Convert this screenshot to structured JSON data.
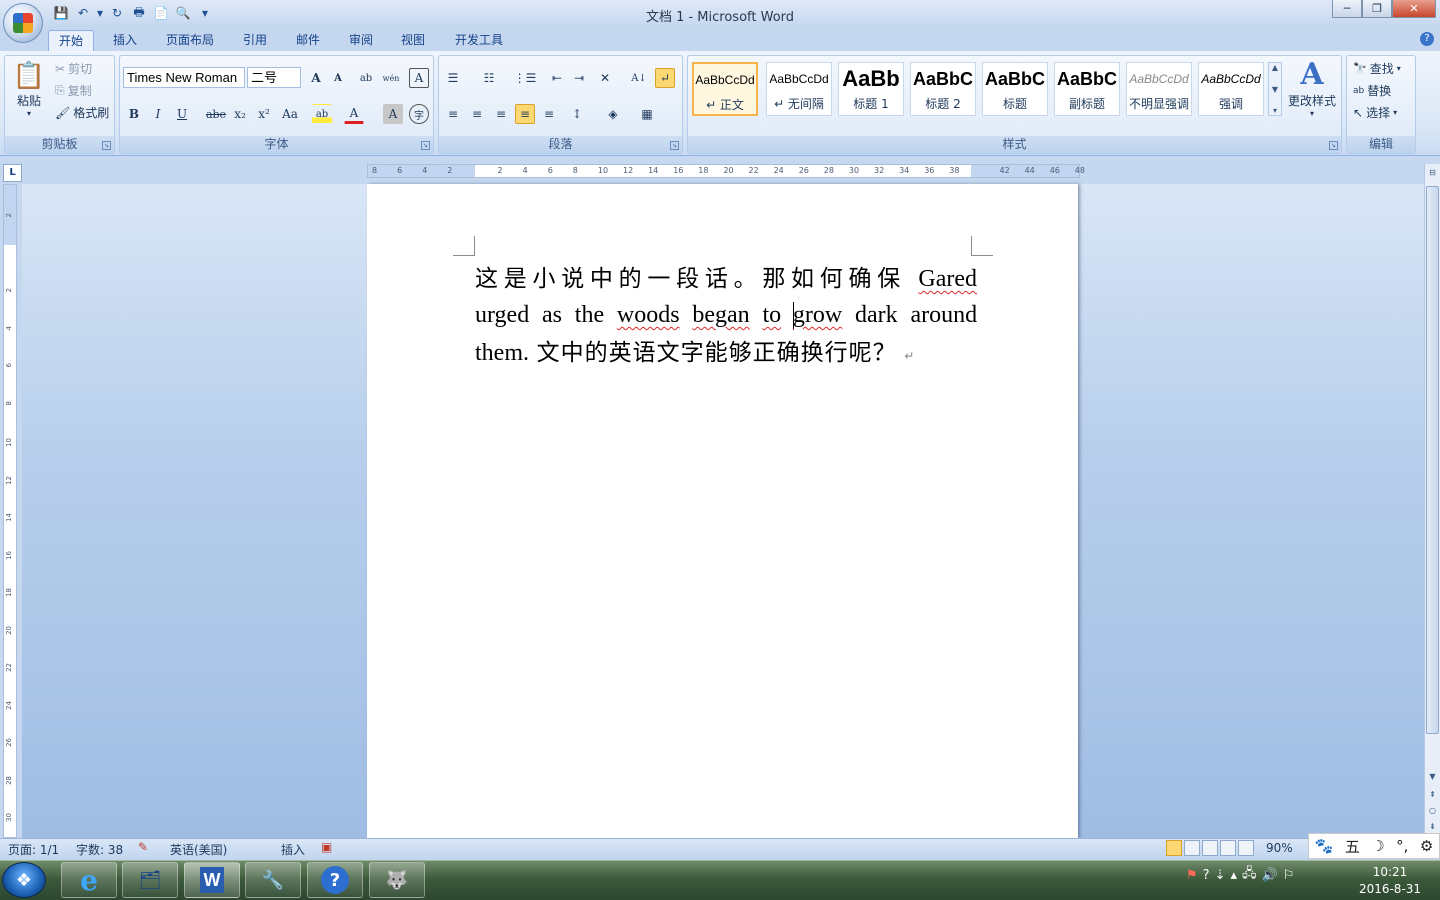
{
  "window": {
    "title": "文档 1 - Microsoft Word",
    "min": "─",
    "max": "❐",
    "close": "✕"
  },
  "qat": {
    "save": "💾",
    "undo": "↶",
    "undo_dd": "▾",
    "redo": "↻",
    "print": "🖶",
    "new": "📄",
    "preview": "🔍",
    "customize": "▾"
  },
  "tabs": [
    "开始",
    "插入",
    "页面布局",
    "引用",
    "邮件",
    "审阅",
    "视图",
    "开发工具"
  ],
  "help": "?",
  "clipboard": {
    "paste": "粘贴",
    "paste_icon": "📋",
    "cut": "剪切",
    "copy": "复制",
    "format_painter": "格式刷",
    "label": "剪贴板",
    "cut_icon": "✂",
    "copy_icon": "⎘",
    "fp_icon": "🖌"
  },
  "font": {
    "name": "Times New Roman",
    "size": "二号",
    "grow": "A",
    "shrink": "A",
    "clear": "ab",
    "phonetic": "wén",
    "border": "A",
    "bold": "B",
    "italic": "I",
    "underline": "U",
    "strike": "abe",
    "subscript": "x₂",
    "superscript": "x²",
    "case": "Aa",
    "highlight": "ab",
    "color": "A",
    "shade": "A",
    "enclose": "字",
    "label": "字体"
  },
  "paragraph": {
    "label": "段落",
    "bullets": "☰",
    "numbering": "☷",
    "multilevel": "⋮☰",
    "dec_indent": "⇤",
    "inc_indent": "⇥",
    "chinese_layout": "✕",
    "sort": "A↓",
    "show_marks": "↵",
    "align_left": "≡",
    "center": "≡",
    "align_right": "≡",
    "justify": "≡",
    "distribute": "≡",
    "line_spacing": "↕",
    "shading": "◈",
    "borders": "▦"
  },
  "styles": {
    "label": "样式",
    "items": [
      {
        "preview": "AaBbCcDd",
        "name": "↵ 正文"
      },
      {
        "preview": "AaBbCcDd",
        "name": "↵ 无间隔"
      },
      {
        "preview": "AaBb",
        "name": "标题 1"
      },
      {
        "preview": "AaBbC",
        "name": "标题 2"
      },
      {
        "preview": "AaBbC",
        "name": "标题"
      },
      {
        "preview": "AaBbC",
        "name": "副标题"
      },
      {
        "preview": "AaBbCcDd",
        "name": "不明显强调"
      },
      {
        "preview": "AaBbCcDd",
        "name": "强调"
      }
    ],
    "change_styles": "更改样式",
    "change_icon": "A"
  },
  "editing": {
    "label": "编辑",
    "find": "查找",
    "replace": "替换",
    "select": "选择",
    "find_icon": "🔭",
    "replace_icon": "ab",
    "select_icon": "↖"
  },
  "ruler": {
    "corner": "L",
    "hnums": [
      "8",
      "6",
      "4",
      "2",
      "",
      "2",
      "4",
      "6",
      "8",
      "10",
      "12",
      "14",
      "16",
      "18",
      "20",
      "22",
      "24",
      "26",
      "28",
      "30",
      "32",
      "34",
      "36",
      "38",
      "",
      "42",
      "44",
      "46",
      "48"
    ],
    "vnums": [
      "2",
      "",
      "2",
      "4",
      "6",
      "8",
      "10",
      "12",
      "14",
      "16",
      "18",
      "20",
      "22",
      "24",
      "26",
      "28",
      "30"
    ]
  },
  "document": {
    "line1_cjk": "这是小说中的一段话。那如何确保",
    "line1_word": "Gared",
    "line2": [
      "urged",
      "as",
      "the",
      "woods",
      "began",
      "to",
      "grow",
      "dark",
      "around"
    ],
    "line3_lat": "them.",
    "line3_cjk": "文中的英语文字能够正确换行呢？",
    "para_mark": "↵"
  },
  "status": {
    "page": "页面: 1/1",
    "words": "字数: 38",
    "proof_icon": "✎",
    "language": "英语(美国)",
    "mode": "插入",
    "macro_icon": "▣",
    "zoom": "90%"
  },
  "ime": {
    "paw": "🐾",
    "wubi": "五",
    "moon": "☽",
    "punct": "°,",
    "gear": "⚙"
  },
  "taskbar": {
    "start": "❖",
    "apps": [
      {
        "name": "ie",
        "icon": "e"
      },
      {
        "name": "explorer",
        "icon": "🗂"
      },
      {
        "name": "word",
        "icon": "W"
      },
      {
        "name": "tool",
        "icon": "🔧"
      },
      {
        "name": "help",
        "icon": "?"
      },
      {
        "name": "gimp",
        "icon": "🐺"
      }
    ]
  },
  "tray": {
    "icons": [
      "⚑",
      "?",
      "⇣",
      "▴",
      "🖧",
      "🔊",
      "⚐"
    ],
    "time": "10:21",
    "date": "2016-8-31"
  }
}
